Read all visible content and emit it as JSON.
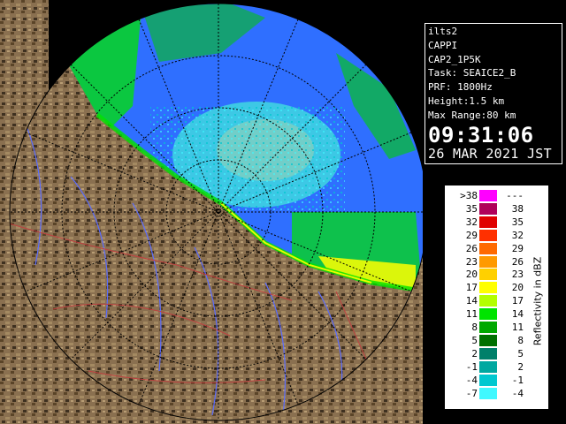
{
  "info": {
    "site": "ilts2",
    "product": "CAPPI",
    "product_id": "CAP2_1P5K",
    "task": "Task: SEAICE2_B",
    "prf": "PRF: 1800Hz",
    "height": "Height:1.5 km",
    "max_range": "Max Range:80 km",
    "time": "09:31:06",
    "date": "26 MAR 2021 JST"
  },
  "legend": {
    "unit": "Reflectivity in dBZ",
    "rows": [
      {
        "left": ">38",
        "right": "---",
        "color": "#ff00ff"
      },
      {
        "left": "35",
        "right": "38",
        "color": "#b0005a"
      },
      {
        "left": "32",
        "right": "35",
        "color": "#e00000"
      },
      {
        "left": "29",
        "right": "32",
        "color": "#ff3000"
      },
      {
        "left": "26",
        "right": "29",
        "color": "#ff6a00"
      },
      {
        "left": "23",
        "right": "26",
        "color": "#ff9a00"
      },
      {
        "left": "20",
        "right": "23",
        "color": "#ffd000"
      },
      {
        "left": "17",
        "right": "20",
        "color": "#ffff00"
      },
      {
        "left": "14",
        "right": "17",
        "color": "#b4ff00"
      },
      {
        "left": "11",
        "right": "14",
        "color": "#00e400"
      },
      {
        "left": "8",
        "right": "11",
        "color": "#00a800"
      },
      {
        "left": "5",
        "right": "8",
        "color": "#007000"
      },
      {
        "left": "2",
        "right": "5",
        "color": "#00806a"
      },
      {
        "left": "-1",
        "right": "2",
        "color": "#00a8a0"
      },
      {
        "left": "-4",
        "right": "-1",
        "color": "#00c8d0"
      },
      {
        "left": "-7",
        "right": "-4",
        "color": "#40f8ff"
      }
    ]
  },
  "colors": {
    "ocean": "#2f6fff",
    "land": "#8a7050",
    "land_dark": "#4a3a22",
    "rivers": "#5a6cff",
    "borders": "#c04040",
    "echo_cyan": "#40f8ff",
    "echo_green": "#00e400",
    "echo_yellow": "#ffff00"
  }
}
